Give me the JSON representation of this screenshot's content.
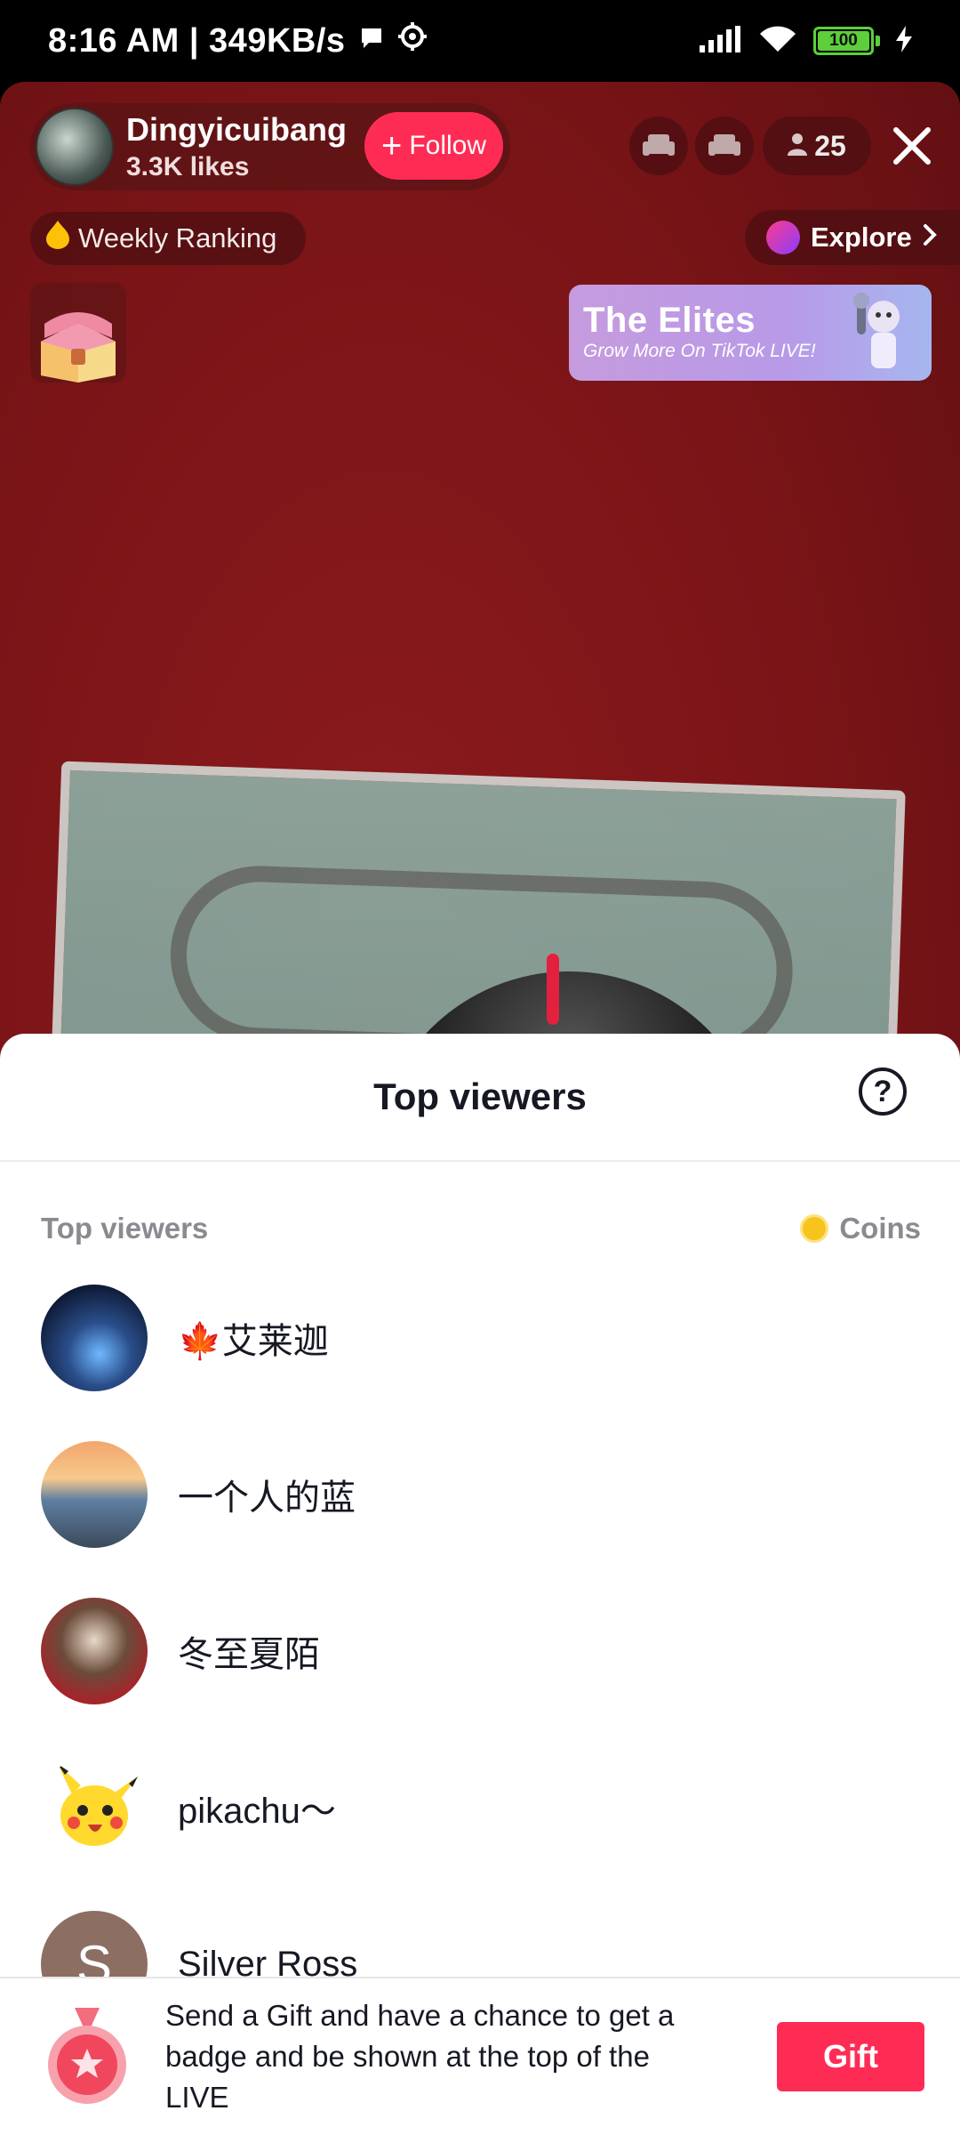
{
  "status_bar": {
    "time_speed": "8:16 AM | 349KB/s",
    "battery": "100"
  },
  "host": {
    "name": "Dingyicuibang",
    "likes": "3.3K likes",
    "follow_label": "Follow"
  },
  "viewer_count": "25",
  "ranking_label": "Weekly Ranking",
  "explore_label": "Explore",
  "banner": {
    "title": "The Elites",
    "subtitle": "Grow More On TikTok LIVE!"
  },
  "sheet": {
    "title": "Top viewers",
    "list_header": "Top viewers",
    "coins_label": "Coins",
    "viewers": [
      {
        "name": "🍁艾莱迦"
      },
      {
        "name": "一个人的蓝"
      },
      {
        "name": "冬至夏陌"
      },
      {
        "name": "pikachu〜"
      },
      {
        "name": "Silver Ross",
        "initial": "S"
      }
    ],
    "gift_prompt": "Send a Gift and have a chance to get a badge and be shown at the top of the LIVE",
    "gift_button": "Gift"
  }
}
